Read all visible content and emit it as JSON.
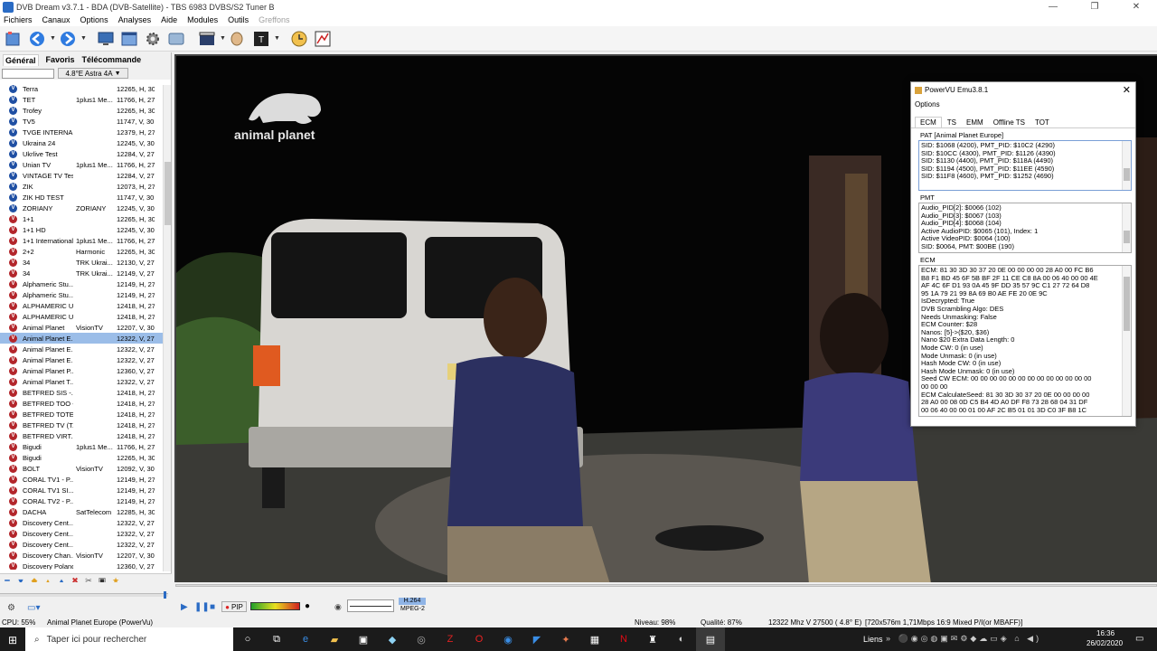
{
  "window": {
    "title": "DVB Dream v3.7.1 - BDA (DVB-Satellite)   -   TBS 6983 DVBS/S2 Tuner B",
    "minimize": "—",
    "maximize": "❐",
    "close": "✕"
  },
  "menu": [
    "Fichiers",
    "Canaux",
    "Options",
    "Analyses",
    "Aide",
    "Modules",
    "Outils",
    "Greffons"
  ],
  "left_tabs": [
    "Général",
    "Favoris",
    "Télécommande"
  ],
  "satellite": "4.8°E Astra 4A",
  "channels": [
    {
      "name": "Terra",
      "provider": "",
      "freq": "12265, H, 30",
      "color": "blue",
      "sel": false
    },
    {
      "name": "TET",
      "provider": "1plus1 Me...",
      "freq": "11766, H, 27",
      "color": "blue",
      "sel": false
    },
    {
      "name": "Trofey",
      "provider": "",
      "freq": "12265, H, 30",
      "color": "blue",
      "sel": false
    },
    {
      "name": "TV5",
      "provider": "",
      "freq": "11747, V, 30",
      "color": "blue",
      "sel": false
    },
    {
      "name": "TVGE INTERNA...",
      "provider": "",
      "freq": "12379, H, 27",
      "color": "blue",
      "sel": false
    },
    {
      "name": "Ukraina 24",
      "provider": "",
      "freq": "12245, V, 30",
      "color": "blue",
      "sel": false
    },
    {
      "name": "Ukrlive Test",
      "provider": "",
      "freq": "12284, V, 27",
      "color": "blue",
      "sel": false
    },
    {
      "name": "Unian TV",
      "provider": "1plus1 Me...",
      "freq": "11766, H, 27",
      "color": "blue",
      "sel": false
    },
    {
      "name": "VINTAGE TV Test",
      "provider": "",
      "freq": "12284, V, 27",
      "color": "blue",
      "sel": false
    },
    {
      "name": "ZIK",
      "provider": "",
      "freq": "12073, H, 27",
      "color": "blue",
      "sel": false
    },
    {
      "name": "ZIK HD TEST",
      "provider": "",
      "freq": "11747, V, 30",
      "color": "blue",
      "sel": false
    },
    {
      "name": "ZORIANY",
      "provider": "ZORIANY",
      "freq": "12245, V, 30",
      "color": "blue",
      "sel": false
    },
    {
      "name": "1+1",
      "provider": "",
      "freq": "12265, H, 30",
      "color": "red",
      "sel": false
    },
    {
      "name": "1+1 HD",
      "provider": "",
      "freq": "12245, V, 30",
      "color": "red",
      "sel": false
    },
    {
      "name": "1+1 International",
      "provider": "1plus1 Me...",
      "freq": "11766, H, 27",
      "color": "red",
      "sel": false
    },
    {
      "name": "2+2",
      "provider": "Harmonic",
      "freq": "12265, H, 30",
      "color": "red",
      "sel": false
    },
    {
      "name": "34",
      "provider": "TRK Ukrai...",
      "freq": "12130, V, 27",
      "color": "red",
      "sel": false
    },
    {
      "name": "34",
      "provider": "TRK Ukrai...",
      "freq": "12149, V, 27",
      "color": "red",
      "sel": false
    },
    {
      "name": "Alphameric Stu...",
      "provider": "",
      "freq": "12149, H, 27",
      "color": "red",
      "sel": false
    },
    {
      "name": "Alphameric Stu...",
      "provider": "",
      "freq": "12149, H, 27",
      "color": "red",
      "sel": false
    },
    {
      "name": "ALPHAMERIC U...",
      "provider": "",
      "freq": "12418, H, 27",
      "color": "red",
      "sel": false
    },
    {
      "name": "ALPHAMERIC U...",
      "provider": "",
      "freq": "12418, H, 27",
      "color": "red",
      "sel": false
    },
    {
      "name": "Animal Planet",
      "provider": "VisionTV",
      "freq": "12207, V, 30",
      "color": "red",
      "sel": false
    },
    {
      "name": "Animal Planet E...",
      "provider": "",
      "freq": "12322, V, 27",
      "color": "red",
      "sel": true
    },
    {
      "name": "Animal Planet E...",
      "provider": "",
      "freq": "12322, V, 27",
      "color": "red",
      "sel": false
    },
    {
      "name": "Animal Planet E...",
      "provider": "",
      "freq": "12322, V, 27",
      "color": "red",
      "sel": false
    },
    {
      "name": "Animal Planet P...",
      "provider": "",
      "freq": "12360, V, 27",
      "color": "red",
      "sel": false
    },
    {
      "name": "Animal Planet T...",
      "provider": "",
      "freq": "12322, V, 27",
      "color": "red",
      "sel": false
    },
    {
      "name": "BETFRED SIS -...",
      "provider": "",
      "freq": "12418, H, 27",
      "color": "red",
      "sel": false
    },
    {
      "name": "BETFRED TOO -...",
      "provider": "",
      "freq": "12418, H, 27",
      "color": "red",
      "sel": false
    },
    {
      "name": "BETFRED TOTE...",
      "provider": "",
      "freq": "12418, H, 27",
      "color": "red",
      "sel": false
    },
    {
      "name": "BETFRED TV (T...",
      "provider": "",
      "freq": "12418, H, 27",
      "color": "red",
      "sel": false
    },
    {
      "name": "BETFRED VIRT...",
      "provider": "",
      "freq": "12418, H, 27",
      "color": "red",
      "sel": false
    },
    {
      "name": "Bigudi",
      "provider": "1plus1 Me...",
      "freq": "11766, H, 27",
      "color": "red",
      "sel": false
    },
    {
      "name": "Bigudi",
      "provider": "",
      "freq": "12265, H, 30",
      "color": "red",
      "sel": false
    },
    {
      "name": "BOLT",
      "provider": "VisionTV",
      "freq": "12092, V, 30",
      "color": "red",
      "sel": false
    },
    {
      "name": "CORAL TV1 - P...",
      "provider": "",
      "freq": "12149, H, 27",
      "color": "red",
      "sel": false
    },
    {
      "name": "CORAL TV1 SI...",
      "provider": "",
      "freq": "12149, H, 27",
      "color": "red",
      "sel": false
    },
    {
      "name": "CORAL TV2 - P...",
      "provider": "",
      "freq": "12149, H, 27",
      "color": "red",
      "sel": false
    },
    {
      "name": "DACHA",
      "provider": "SatTelecom",
      "freq": "12285, H, 30",
      "color": "red",
      "sel": false
    },
    {
      "name": "Discovery Cent...",
      "provider": "",
      "freq": "12322, V, 27",
      "color": "red",
      "sel": false
    },
    {
      "name": "Discovery Cent...",
      "provider": "",
      "freq": "12322, V, 27",
      "color": "red",
      "sel": false
    },
    {
      "name": "Discovery Cent...",
      "provider": "",
      "freq": "12322, V, 27",
      "color": "red",
      "sel": false
    },
    {
      "name": "Discovery Chan...",
      "provider": "VisionTV",
      "freq": "12207, V, 30",
      "color": "red",
      "sel": false
    },
    {
      "name": "Discovery Poland",
      "provider": "",
      "freq": "12360, V, 27",
      "color": "red",
      "sel": false
    }
  ],
  "player": {
    "pip": "PIP",
    "codec1": "H.264",
    "codec2": "MPEG-2"
  },
  "status": {
    "cpu": "CPU: 55%",
    "channel": "Animal Planet Europe (PowerVu)",
    "niveau": "Niveau: 98%",
    "qualite": "Qualité: 87%",
    "freq": "12322 Mhz  V  27500  ( 4.8° E)",
    "video": "[720x576m  1,71Mbps   16:9 Mixed P/I(or MBAFF)]"
  },
  "video_logo": {
    "brand": "animal planet"
  },
  "emu": {
    "title": "PowerVU Emu3.8.1",
    "options": "Options",
    "tabs": [
      "ECM",
      "TS",
      "EMM",
      "Offline TS",
      "TOT"
    ],
    "pat_label": "PAT [Animal Planet Europe]",
    "pat_lines": [
      "SID: $1068 (4200), PMT_PID: $10C2 (4290)",
      "SID: $10CC (4300), PMT_PID: $1126 (4390)",
      "SID: $1130 (4400), PMT_PID: $118A (4490)",
      "SID: $1194 (4500), PMT_PID: $11EE (4590)",
      "SID: $11F8 (4600), PMT_PID: $1252 (4690)"
    ],
    "pmt_label": "PMT",
    "pmt_lines": [
      "Audio_PID[2]: $0066 (102)",
      "Audio_PID[3]: $0067 (103)",
      "Audio_PID[4]: $0068 (104)",
      "Active AudioPID: $0065 (101), Index: 1",
      "Active VideoPID: $0064 (100)",
      "SID: $0064, PMT: $00BE (190)"
    ],
    "ecm_label": "ECM",
    "ecm_lines": [
      "ECM: 81 30 3D 30 37 20 0E 00 00 00 00 28 A0 00 FC B6",
      "B8 F1 BD 45 6F 5B BF 2F 11 CE C8 8A 00 06 40 00 00 4E",
      "AF 4C 6F D1 93 0A 45 9F DD 35 57 9C C1 27 72 64 D8",
      "95 1A 79 21 99 8A 69 B0 AE FE 20 0E 9C",
      "IsDecrypted: True",
      "DVB Scrambling Algo: DES",
      "Needs Unmasking: False",
      "ECM Counter: $28",
      "Nanos: [5]->($20, $36)",
      "Nano $20 Extra Data Length: 0",
      "Mode CW: 0 (in use)",
      "Mode Unmask: 0 (in use)",
      "Hash Mode CW: 0 (in use)",
      "Hash Mode Unmask: 0 (in use)",
      "Seed CW ECM: 00 00 00 00 00 00 00 00 00 00 00 00 00",
      "00 00 00",
      "ECM CalculateSeed: 81 30 3D 30 37 20 0E 00 00 00 00",
      "28 A0 00 08 0D C5 B4 4D A0 DF F8 73 28 68 04 31 DF",
      "00 06 40 00 00 01 00 AF 2C B5 01 01 3D C0 3F B8 1C"
    ]
  },
  "taskbar": {
    "search_placeholder": "Taper ici pour rechercher",
    "links": "Liens",
    "time": "16:36",
    "date": "26/02/2020"
  }
}
